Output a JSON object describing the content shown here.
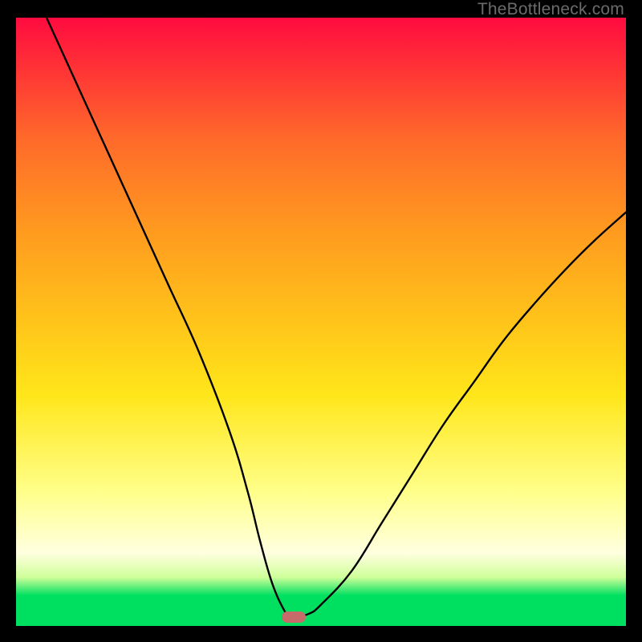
{
  "watermark": "TheBottleneck.com",
  "colors": {
    "top": "#ff0b3f",
    "mid_red_orange": "#ff6a2a",
    "mid_orange": "#ff9a1f",
    "mid_yellow_orange": "#ffc41a",
    "mid_yellow": "#ffe61a",
    "pale_yellow": "#ffff8a",
    "white": "#ffffe0",
    "near_bottom": "#cfff9a",
    "green": "#00e060",
    "curve": "#000000",
    "marker": "#c76a6a",
    "frame": "#000000"
  },
  "chart_data": {
    "type": "line",
    "title": "",
    "xlabel": "",
    "ylabel": "",
    "xlim": [
      0,
      100
    ],
    "ylim": [
      0,
      100
    ],
    "series": [
      {
        "name": "bottleneck-curve",
        "x": [
          5,
          10,
          15,
          20,
          25,
          30,
          35,
          38,
          40,
          42,
          44,
          45,
          46,
          48,
          50,
          55,
          60,
          65,
          70,
          75,
          80,
          85,
          90,
          95,
          100
        ],
        "y": [
          100,
          89,
          78,
          67,
          56,
          45,
          32,
          22,
          14,
          7,
          2.5,
          1.5,
          1.5,
          2,
          3.5,
          9,
          17,
          25,
          33,
          40,
          47,
          53,
          58.5,
          63.5,
          68
        ]
      }
    ],
    "marker": {
      "x": 45.5,
      "y": 1.5
    },
    "gradient_stops_pct": [
      0,
      20,
      35,
      50,
      62,
      78,
      88,
      92,
      95,
      100
    ]
  }
}
